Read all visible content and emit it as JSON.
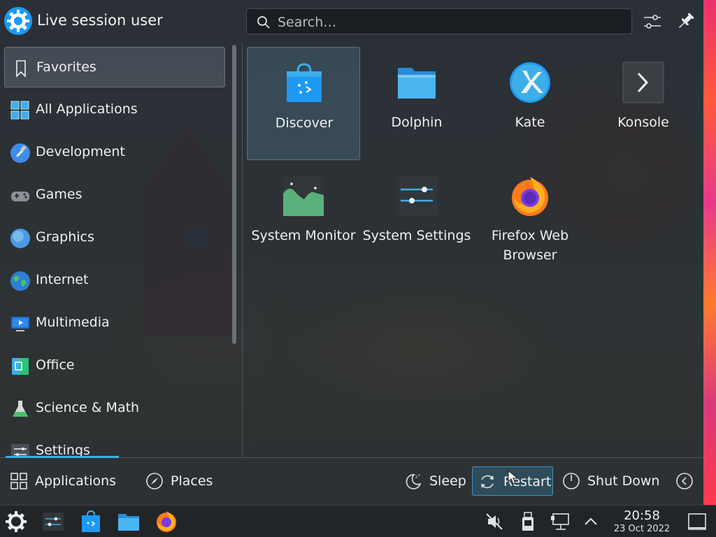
{
  "header": {
    "username": "Live session user",
    "search_placeholder": "Search…"
  },
  "sidebar": {
    "items": [
      {
        "label": "Favorites",
        "icon": "bookmark-icon",
        "active": true
      },
      {
        "label": "All Applications",
        "icon": "grid-icon"
      },
      {
        "label": "Development",
        "icon": "hammer-icon"
      },
      {
        "label": "Games",
        "icon": "gamepad-icon"
      },
      {
        "label": "Graphics",
        "icon": "graphics-icon"
      },
      {
        "label": "Internet",
        "icon": "globe-icon"
      },
      {
        "label": "Multimedia",
        "icon": "monitor-play-icon"
      },
      {
        "label": "Office",
        "icon": "office-icon"
      },
      {
        "label": "Science & Math",
        "icon": "flask-icon"
      },
      {
        "label": "Settings",
        "icon": "settings-icon"
      }
    ]
  },
  "apps": [
    {
      "name": "Discover",
      "icon": "discover-icon"
    },
    {
      "name": "Dolphin",
      "icon": "folder-icon"
    },
    {
      "name": "Kate",
      "icon": "kate-icon"
    },
    {
      "name": "Konsole",
      "icon": "terminal-icon"
    },
    {
      "name": "System Monitor",
      "icon": "system-monitor-icon"
    },
    {
      "name": "System Settings",
      "icon": "system-settings-icon"
    },
    {
      "name": "Firefox Web Browser",
      "icon": "firefox-icon"
    }
  ],
  "footer": {
    "applications": "Applications",
    "places": "Places",
    "sleep": "Sleep",
    "restart": "Restart",
    "shutdown": "Shut Down"
  },
  "taskbar": {
    "time": "20:58",
    "date": "23 Oct 2022"
  },
  "colors": {
    "accent": "#3daee9",
    "panel": "#282c32"
  }
}
